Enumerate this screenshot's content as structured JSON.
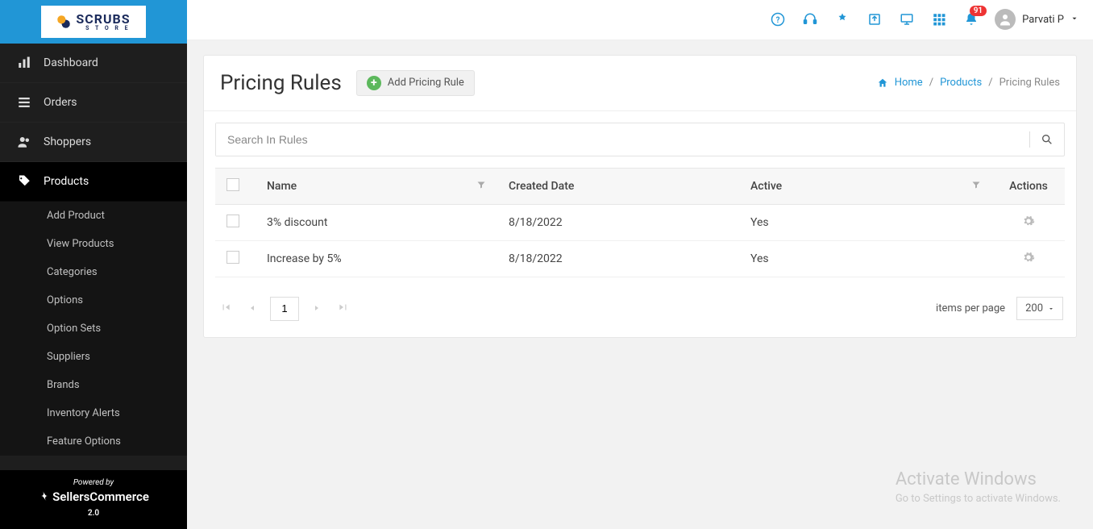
{
  "logo": {
    "line1": "SCRUBS",
    "line2": "S T O R E"
  },
  "sidebar": {
    "items": [
      {
        "label": "Dashboard"
      },
      {
        "label": "Orders"
      },
      {
        "label": "Shoppers"
      },
      {
        "label": "Products"
      }
    ],
    "sub_items": [
      {
        "label": "Add Product"
      },
      {
        "label": "View Products"
      },
      {
        "label": "Categories"
      },
      {
        "label": "Options"
      },
      {
        "label": "Option Sets"
      },
      {
        "label": "Suppliers"
      },
      {
        "label": "Brands"
      },
      {
        "label": "Inventory Alerts"
      },
      {
        "label": "Feature Options"
      }
    ]
  },
  "powered": {
    "by": "Powered by",
    "brand": "SellersCommerce",
    "version": "2.0"
  },
  "topbar": {
    "notification_count": "91",
    "user_name": "Parvati P"
  },
  "header": {
    "title": "Pricing Rules",
    "add_button": "Add Pricing Rule"
  },
  "breadcrumb": {
    "home": "Home",
    "level1": "Products",
    "current": "Pricing Rules"
  },
  "search": {
    "placeholder": "Search In Rules"
  },
  "table": {
    "columns": {
      "name": "Name",
      "created": "Created Date",
      "active": "Active",
      "actions": "Actions"
    },
    "rows": [
      {
        "name": "3% discount",
        "created": "8/18/2022",
        "active": "Yes"
      },
      {
        "name": "Increase by 5%",
        "created": "8/18/2022",
        "active": "Yes"
      }
    ]
  },
  "pager": {
    "page": "1",
    "items_per_page_label": "items per page",
    "per_page_value": "200"
  },
  "watermark": {
    "heading": "Activate Windows",
    "sub": "Go to Settings to activate Windows."
  }
}
